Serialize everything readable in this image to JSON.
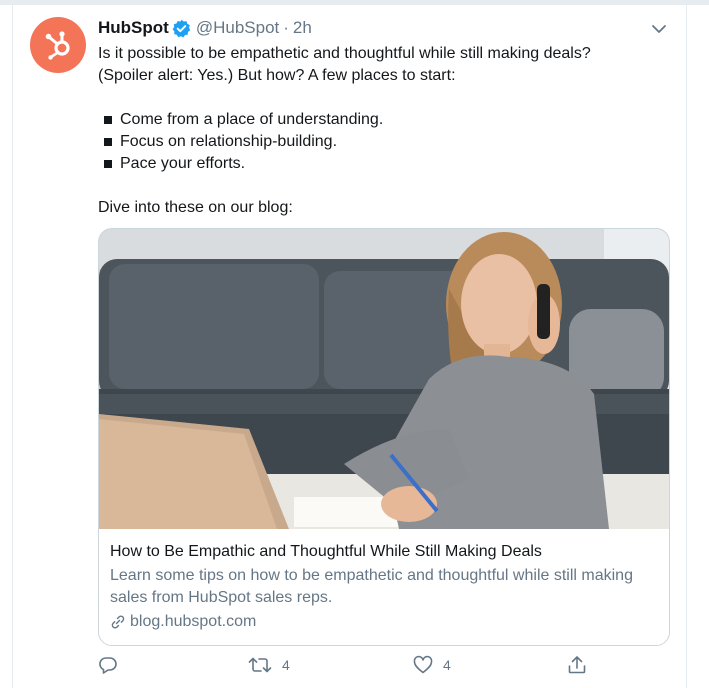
{
  "tweet": {
    "name": "HubSpot",
    "handle": "@HubSpot",
    "separator": "·",
    "time": "2h",
    "text_line1": "Is it possible to be empathetic and thoughtful while still making deals?",
    "text_line2": "(Spoiler alert: Yes.) But how? A few places to start:",
    "bullets": [
      "Come from a place of understanding.",
      "Focus on relationship-building.",
      "Pace your efforts."
    ],
    "outro": "Dive into these on our blog:"
  },
  "card": {
    "title": "How to Be Empathic and Thoughtful While Still Making Deals",
    "description": "Learn some tips on how to be empathetic and thoughtful while still making sales from HubSpot sales reps.",
    "domain": "blog.hubspot.com"
  },
  "actions": {
    "retweet_count": "4",
    "like_count": "4"
  },
  "colors": {
    "brand": "#f47458",
    "verified": "#1da1f2",
    "secondary_text": "#657786"
  },
  "icons": [
    "hubspot-logo-icon",
    "verified-badge-icon",
    "chevron-down-icon",
    "link-icon",
    "reply-icon",
    "retweet-icon",
    "like-icon",
    "share-icon"
  ]
}
